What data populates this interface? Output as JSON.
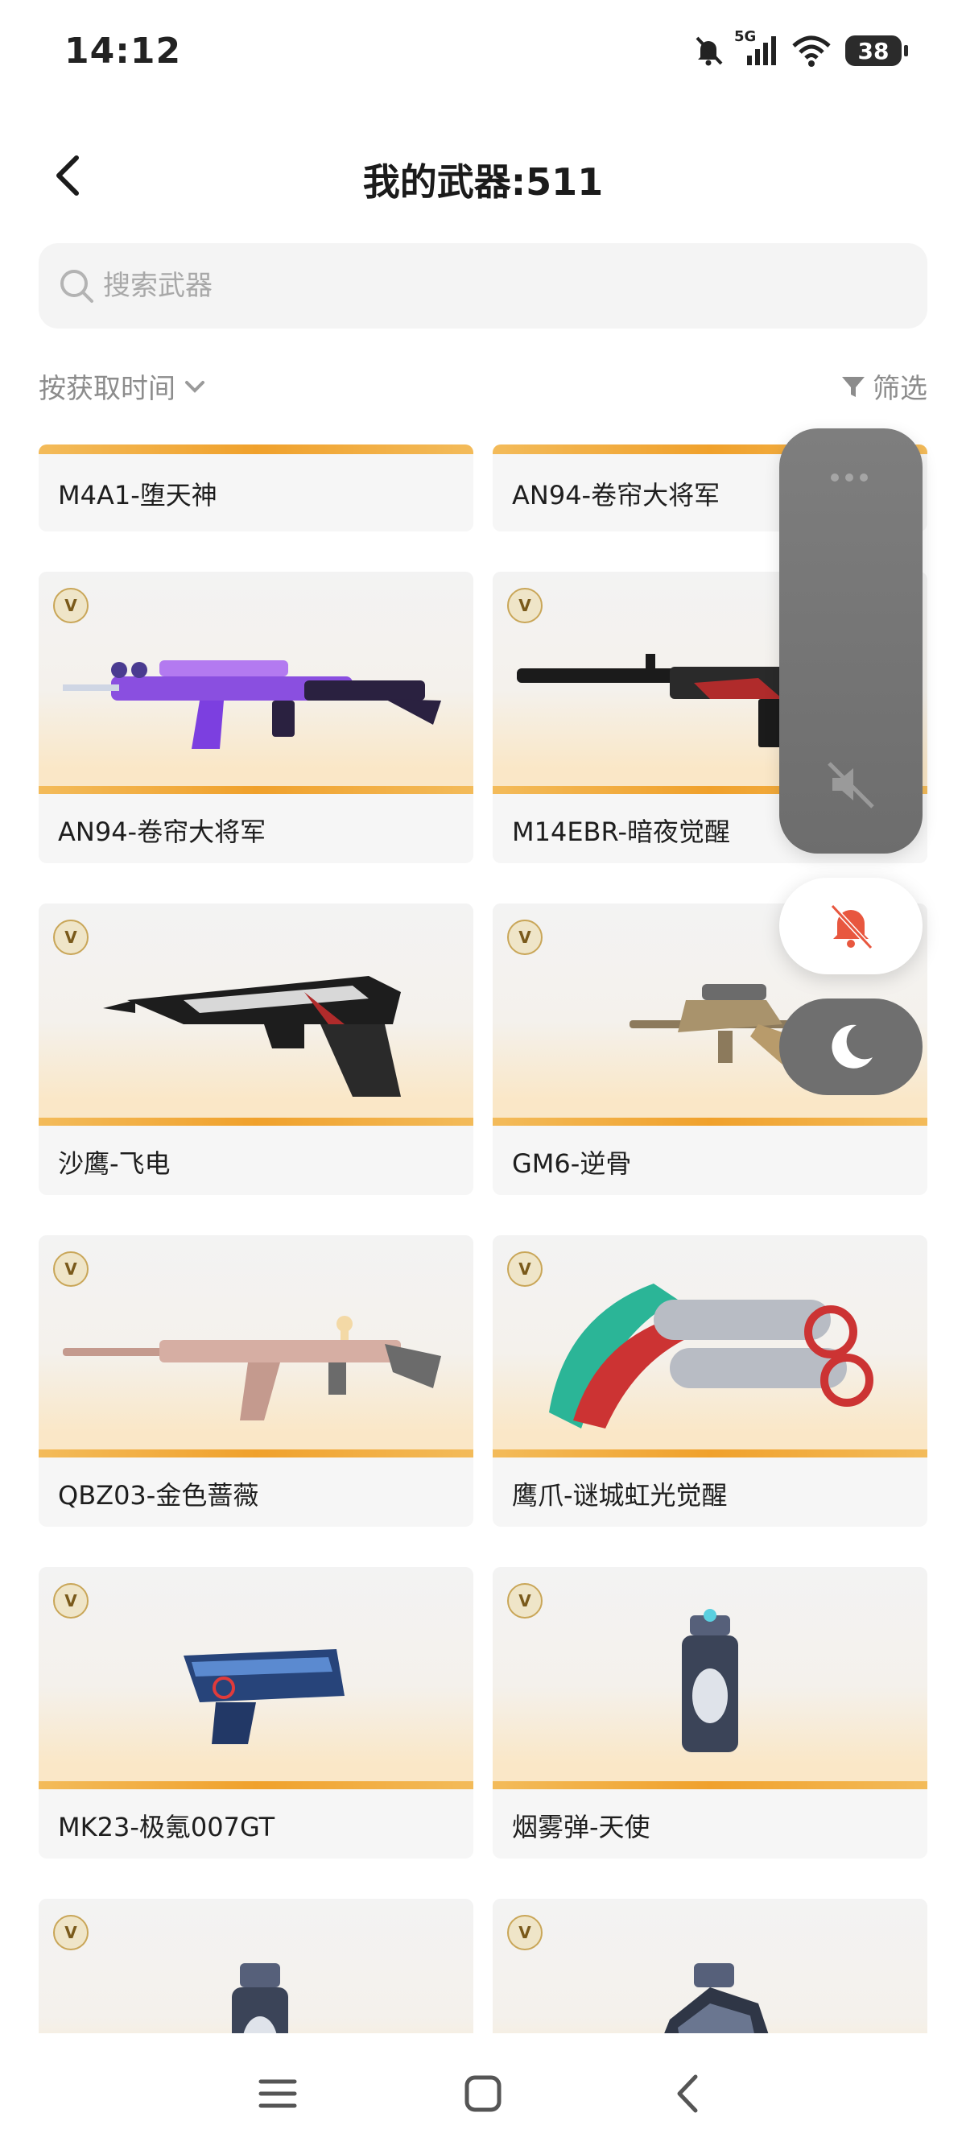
{
  "status": {
    "time": "14:12",
    "network": "5G",
    "battery": "38"
  },
  "header": {
    "title": "我的武器:511"
  },
  "search": {
    "placeholder": "搜索武器"
  },
  "sortbar": {
    "sort_label": "按获取时间",
    "filter_label": "筛选"
  },
  "weapons": [
    {
      "name": "M4A1-堕天神",
      "badge": "V"
    },
    {
      "name": "AN94-卷帘大将军",
      "badge": "V"
    },
    {
      "name": "AN94-卷帘大将军",
      "badge": "V"
    },
    {
      "name": "M14EBR-暗夜觉醒",
      "badge": "V"
    },
    {
      "name": "沙鹰-飞电",
      "badge": "V"
    },
    {
      "name": "GM6-逆骨",
      "badge": "V"
    },
    {
      "name": "QBZ03-金色蔷薇",
      "badge": "V"
    },
    {
      "name": "鹰爪-谜城虹光觉醒",
      "badge": "V"
    },
    {
      "name": "MK23-极氪007GT",
      "badge": "V"
    },
    {
      "name": "烟雾弹-天使",
      "badge": "V"
    },
    {
      "name": "",
      "badge": "V"
    },
    {
      "name": "",
      "badge": "V"
    }
  ],
  "colors": {
    "accent_bar": "#f0a12c",
    "bell_icon": "#e8573f",
    "panel": "#6f6f6f"
  }
}
